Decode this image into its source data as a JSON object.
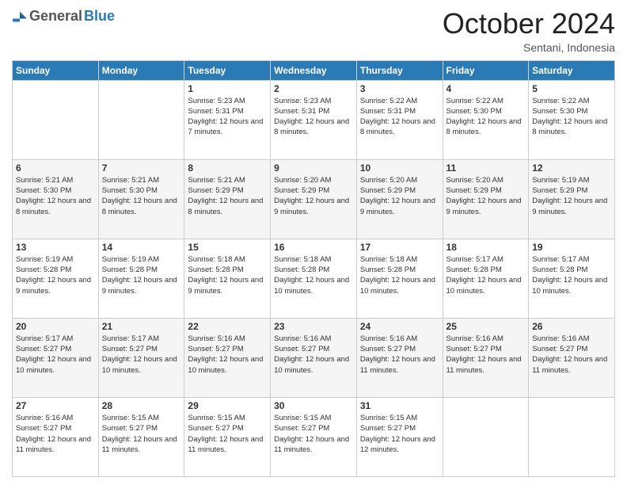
{
  "header": {
    "logo": {
      "general": "General",
      "blue": "Blue",
      "tagline": ""
    },
    "title": "October 2024",
    "location": "Sentani, Indonesia"
  },
  "weekdays": [
    "Sunday",
    "Monday",
    "Tuesday",
    "Wednesday",
    "Thursday",
    "Friday",
    "Saturday"
  ],
  "weeks": [
    [
      {
        "day": "",
        "info": ""
      },
      {
        "day": "",
        "info": ""
      },
      {
        "day": "1",
        "info": "Sunrise: 5:23 AM\nSunset: 5:31 PM\nDaylight: 12 hours and 7 minutes."
      },
      {
        "day": "2",
        "info": "Sunrise: 5:23 AM\nSunset: 5:31 PM\nDaylight: 12 hours and 8 minutes."
      },
      {
        "day": "3",
        "info": "Sunrise: 5:22 AM\nSunset: 5:31 PM\nDaylight: 12 hours and 8 minutes."
      },
      {
        "day": "4",
        "info": "Sunrise: 5:22 AM\nSunset: 5:30 PM\nDaylight: 12 hours and 8 minutes."
      },
      {
        "day": "5",
        "info": "Sunrise: 5:22 AM\nSunset: 5:30 PM\nDaylight: 12 hours and 8 minutes."
      }
    ],
    [
      {
        "day": "6",
        "info": "Sunrise: 5:21 AM\nSunset: 5:30 PM\nDaylight: 12 hours and 8 minutes."
      },
      {
        "day": "7",
        "info": "Sunrise: 5:21 AM\nSunset: 5:30 PM\nDaylight: 12 hours and 8 minutes."
      },
      {
        "day": "8",
        "info": "Sunrise: 5:21 AM\nSunset: 5:29 PM\nDaylight: 12 hours and 8 minutes."
      },
      {
        "day": "9",
        "info": "Sunrise: 5:20 AM\nSunset: 5:29 PM\nDaylight: 12 hours and 9 minutes."
      },
      {
        "day": "10",
        "info": "Sunrise: 5:20 AM\nSunset: 5:29 PM\nDaylight: 12 hours and 9 minutes."
      },
      {
        "day": "11",
        "info": "Sunrise: 5:20 AM\nSunset: 5:29 PM\nDaylight: 12 hours and 9 minutes."
      },
      {
        "day": "12",
        "info": "Sunrise: 5:19 AM\nSunset: 5:29 PM\nDaylight: 12 hours and 9 minutes."
      }
    ],
    [
      {
        "day": "13",
        "info": "Sunrise: 5:19 AM\nSunset: 5:28 PM\nDaylight: 12 hours and 9 minutes."
      },
      {
        "day": "14",
        "info": "Sunrise: 5:19 AM\nSunset: 5:28 PM\nDaylight: 12 hours and 9 minutes."
      },
      {
        "day": "15",
        "info": "Sunrise: 5:18 AM\nSunset: 5:28 PM\nDaylight: 12 hours and 9 minutes."
      },
      {
        "day": "16",
        "info": "Sunrise: 5:18 AM\nSunset: 5:28 PM\nDaylight: 12 hours and 10 minutes."
      },
      {
        "day": "17",
        "info": "Sunrise: 5:18 AM\nSunset: 5:28 PM\nDaylight: 12 hours and 10 minutes."
      },
      {
        "day": "18",
        "info": "Sunrise: 5:17 AM\nSunset: 5:28 PM\nDaylight: 12 hours and 10 minutes."
      },
      {
        "day": "19",
        "info": "Sunrise: 5:17 AM\nSunset: 5:28 PM\nDaylight: 12 hours and 10 minutes."
      }
    ],
    [
      {
        "day": "20",
        "info": "Sunrise: 5:17 AM\nSunset: 5:27 PM\nDaylight: 12 hours and 10 minutes."
      },
      {
        "day": "21",
        "info": "Sunrise: 5:17 AM\nSunset: 5:27 PM\nDaylight: 12 hours and 10 minutes."
      },
      {
        "day": "22",
        "info": "Sunrise: 5:16 AM\nSunset: 5:27 PM\nDaylight: 12 hours and 10 minutes."
      },
      {
        "day": "23",
        "info": "Sunrise: 5:16 AM\nSunset: 5:27 PM\nDaylight: 12 hours and 10 minutes."
      },
      {
        "day": "24",
        "info": "Sunrise: 5:16 AM\nSunset: 5:27 PM\nDaylight: 12 hours and 11 minutes."
      },
      {
        "day": "25",
        "info": "Sunrise: 5:16 AM\nSunset: 5:27 PM\nDaylight: 12 hours and 11 minutes."
      },
      {
        "day": "26",
        "info": "Sunrise: 5:16 AM\nSunset: 5:27 PM\nDaylight: 12 hours and 11 minutes."
      }
    ],
    [
      {
        "day": "27",
        "info": "Sunrise: 5:16 AM\nSunset: 5:27 PM\nDaylight: 12 hours and 11 minutes."
      },
      {
        "day": "28",
        "info": "Sunrise: 5:15 AM\nSunset: 5:27 PM\nDaylight: 12 hours and 11 minutes."
      },
      {
        "day": "29",
        "info": "Sunrise: 5:15 AM\nSunset: 5:27 PM\nDaylight: 12 hours and 11 minutes."
      },
      {
        "day": "30",
        "info": "Sunrise: 5:15 AM\nSunset: 5:27 PM\nDaylight: 12 hours and 11 minutes."
      },
      {
        "day": "31",
        "info": "Sunrise: 5:15 AM\nSunset: 5:27 PM\nDaylight: 12 hours and 12 minutes."
      },
      {
        "day": "",
        "info": ""
      },
      {
        "day": "",
        "info": ""
      }
    ]
  ]
}
